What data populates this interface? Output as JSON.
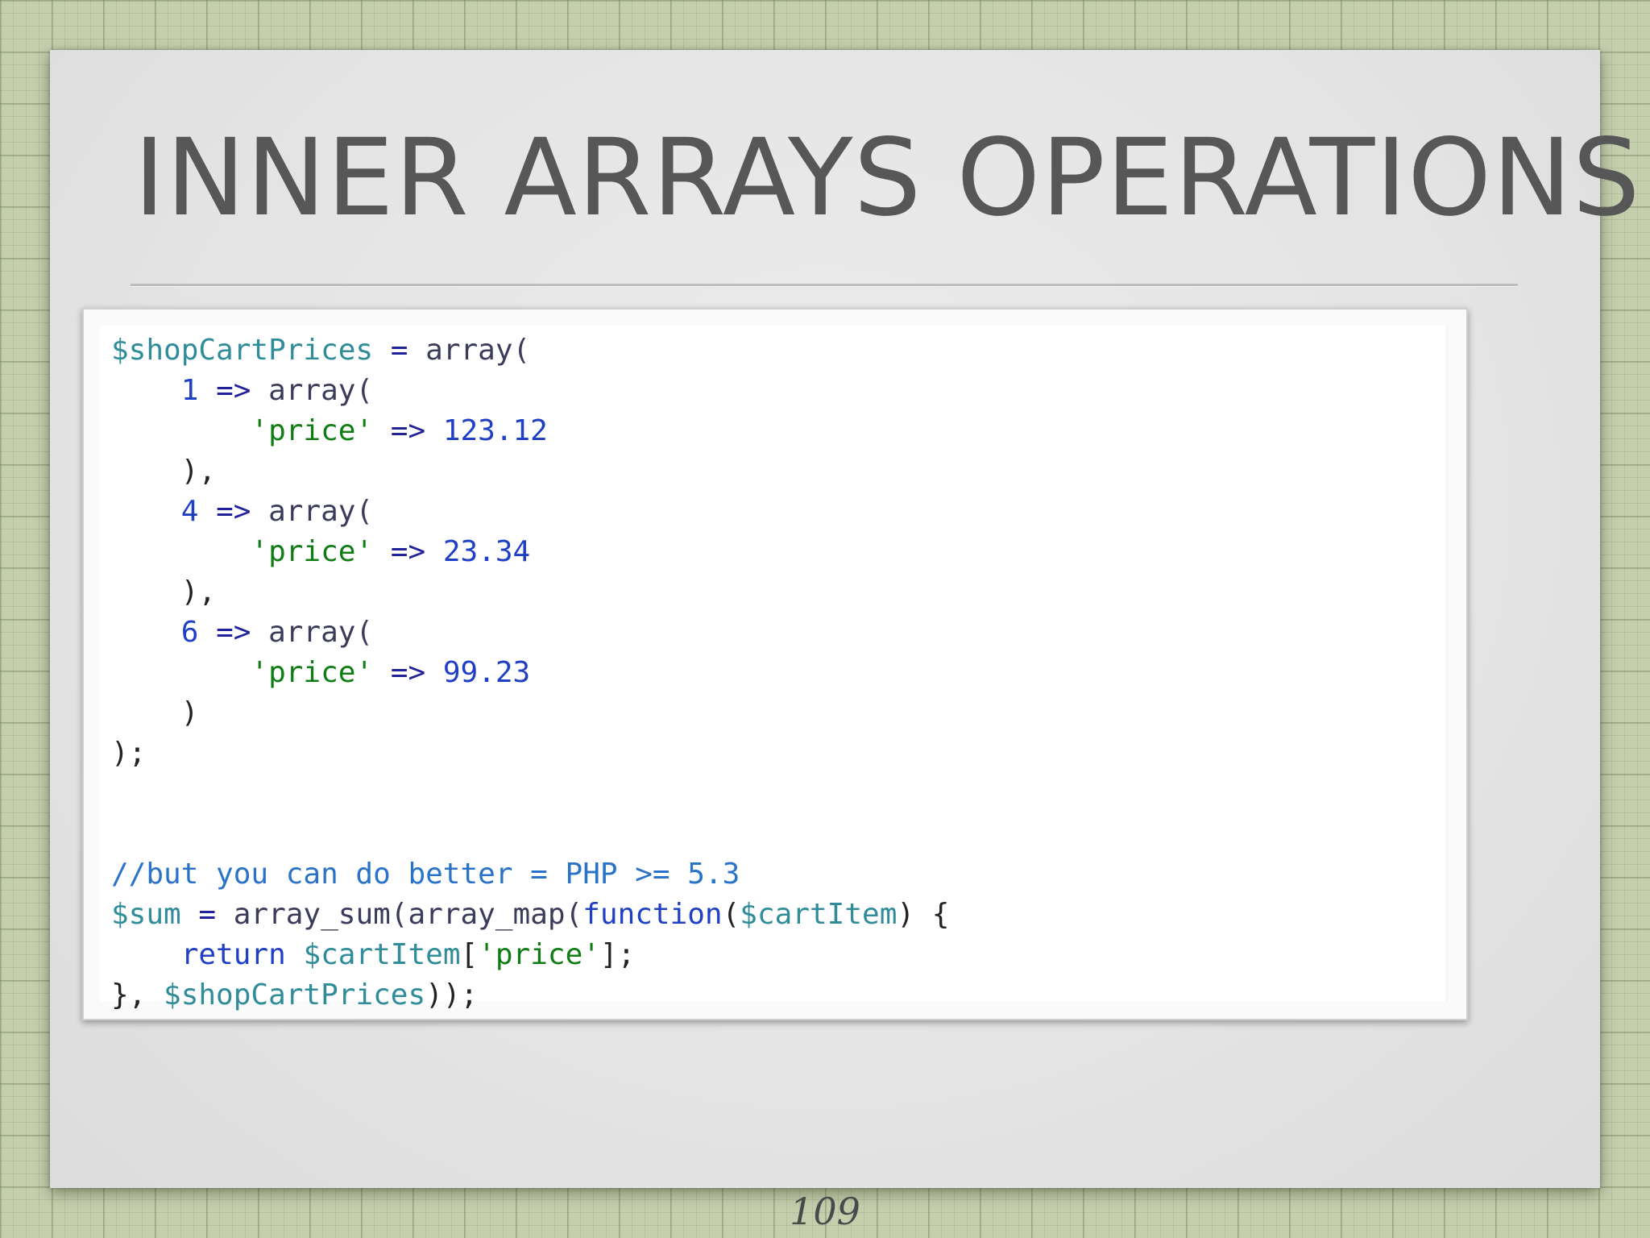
{
  "slide": {
    "title": "INNER ARRAYS OPERATIONS",
    "page_number": "109"
  },
  "code": {
    "lines": [
      [
        {
          "t": "$shopCartPrices",
          "c": "var"
        },
        {
          "t": " = ",
          "c": "op"
        },
        {
          "t": "array(",
          "c": "fn"
        }
      ],
      [
        {
          "t": "    ",
          "c": ""
        },
        {
          "t": "1",
          "c": "num"
        },
        {
          "t": " => ",
          "c": "op"
        },
        {
          "t": "array(",
          "c": "fn"
        }
      ],
      [
        {
          "t": "        ",
          "c": ""
        },
        {
          "t": "'price'",
          "c": "str"
        },
        {
          "t": " => ",
          "c": "op"
        },
        {
          "t": "123.12",
          "c": "num"
        }
      ],
      [
        {
          "t": "    ),",
          "c": ""
        }
      ],
      [
        {
          "t": "    ",
          "c": ""
        },
        {
          "t": "4",
          "c": "num"
        },
        {
          "t": " => ",
          "c": "op"
        },
        {
          "t": "array(",
          "c": "fn"
        }
      ],
      [
        {
          "t": "        ",
          "c": ""
        },
        {
          "t": "'price'",
          "c": "str"
        },
        {
          "t": " => ",
          "c": "op"
        },
        {
          "t": "23.34",
          "c": "num"
        }
      ],
      [
        {
          "t": "    ),",
          "c": ""
        }
      ],
      [
        {
          "t": "    ",
          "c": ""
        },
        {
          "t": "6",
          "c": "num"
        },
        {
          "t": " => ",
          "c": "op"
        },
        {
          "t": "array(",
          "c": "fn"
        }
      ],
      [
        {
          "t": "        ",
          "c": ""
        },
        {
          "t": "'price'",
          "c": "str"
        },
        {
          "t": " => ",
          "c": "op"
        },
        {
          "t": "99.23",
          "c": "num"
        }
      ],
      [
        {
          "t": "    )",
          "c": ""
        }
      ],
      [
        {
          "t": ");",
          "c": ""
        }
      ],
      [],
      [],
      [
        {
          "t": "//but you can do better = PHP >= 5.3",
          "c": "cmt"
        }
      ],
      [
        {
          "t": "$sum",
          "c": "var"
        },
        {
          "t": " = ",
          "c": "op"
        },
        {
          "t": "array_sum(array_map(",
          "c": "fn"
        },
        {
          "t": "function",
          "c": "kw"
        },
        {
          "t": "(",
          "c": ""
        },
        {
          "t": "$cartItem",
          "c": "var"
        },
        {
          "t": ") {",
          "c": ""
        }
      ],
      [
        {
          "t": "    ",
          "c": ""
        },
        {
          "t": "return",
          "c": "kw"
        },
        {
          "t": " ",
          "c": ""
        },
        {
          "t": "$cartItem",
          "c": "var"
        },
        {
          "t": "[",
          "c": ""
        },
        {
          "t": "'price'",
          "c": "str"
        },
        {
          "t": "];",
          "c": ""
        }
      ],
      [
        {
          "t": "}, ",
          "c": ""
        },
        {
          "t": "$shopCartPrices",
          "c": "var"
        },
        {
          "t": "));",
          "c": ""
        }
      ]
    ]
  },
  "colors": {
    "variable": "#2f8c98",
    "number": "#1f3fc4",
    "string": "#0f7d14",
    "comment": "#2a73c8",
    "title": "#575757",
    "background": "#c5cfae"
  }
}
